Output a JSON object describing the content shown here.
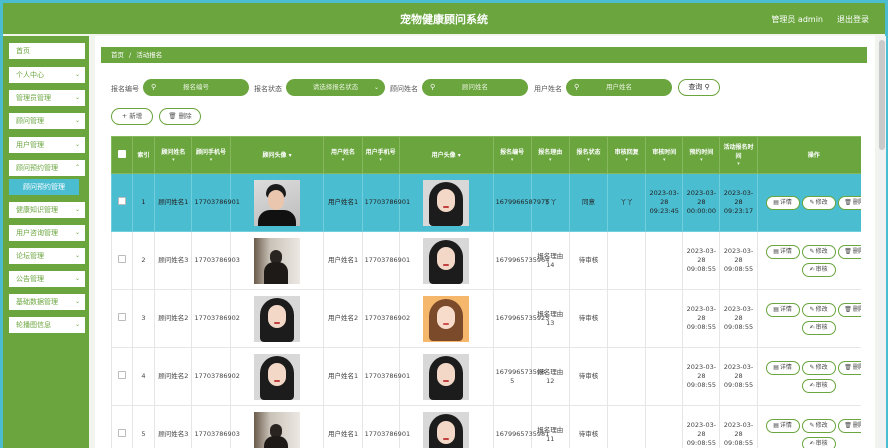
{
  "header": {
    "title": "宠物健康顾问系统",
    "admin": "管理员 admin",
    "logout": "退出登录"
  },
  "sidebar": {
    "items": [
      "首页",
      "个人中心",
      "管理员管理",
      "顾问管理",
      "用户管理",
      "顾问预约管理",
      "健康知识管理",
      "用户咨询管理",
      "论坛管理",
      "公告管理",
      "基础数据管理",
      "轮播图信息"
    ],
    "sub_item": "顾问预约管理"
  },
  "breadcrumb": {
    "home": "首页",
    "sep": "/",
    "current": "活动报名"
  },
  "filters": {
    "f1_label": "报名编号",
    "f1_placeholder": "报名编号",
    "f2_label": "报名状态",
    "f2_placeholder": "请选择报名状态",
    "f3_label": "顾问姓名",
    "f3_placeholder": "顾问姓名",
    "f4_label": "用户姓名",
    "f4_placeholder": "用户姓名",
    "query": "查询"
  },
  "actions": {
    "add": "新增",
    "delete": "删除"
  },
  "table": {
    "headers": [
      "索引",
      "顾问姓名",
      "顾问手机号",
      "顾问头像",
      "用户姓名",
      "用户手机号",
      "用户头像",
      "报名编号",
      "报名理由",
      "报名状态",
      "审核回复",
      "审核时间",
      "预约时间",
      "活动报名时间",
      "操作"
    ],
    "rows": [
      {
        "idx": "1",
        "gname": "顾问姓名1",
        "gphone": "17703786901",
        "uname": "用户姓名1",
        "uphone": "17703786901",
        "code": "1679966587975",
        "reason": "丫丫",
        "status": "同意",
        "reply": "丫丫",
        "atime": "2023-03-28 09:23:45",
        "btime": "2023-03-28 00:00:00",
        "stime": "2023-03-28 09:23:17",
        "audit": ""
      },
      {
        "idx": "2",
        "gname": "顾问姓名3",
        "gphone": "17703786903",
        "uname": "用户姓名1",
        "uphone": "17703786901",
        "code": "1679965735964",
        "reason": "报名理由14",
        "status": "待审核",
        "reply": "",
        "atime": "",
        "btime": "2023-03-28 09:08:55",
        "stime": "2023-03-28 09:08:55",
        "audit": "审核"
      },
      {
        "idx": "3",
        "gname": "顾问姓名2",
        "gphone": "17703786902",
        "uname": "用户姓名2",
        "uphone": "17703786902",
        "code": "1679965735925",
        "reason": "报名理由13",
        "status": "待审核",
        "reply": "",
        "atime": "",
        "btime": "2023-03-28 09:08:55",
        "stime": "2023-03-28 09:08:55",
        "audit": "审核"
      },
      {
        "idx": "4",
        "gname": "顾问姓名2",
        "gphone": "17703786902",
        "uname": "用户姓名1",
        "uphone": "17703786901",
        "code": "167996573598 5",
        "reason": "报名理由12",
        "status": "待审核",
        "reply": "",
        "atime": "",
        "btime": "2023-03-28 09:08:55",
        "stime": "2023-03-28 09:08:55",
        "audit": "审核"
      },
      {
        "idx": "5",
        "gname": "顾问姓名3",
        "gphone": "17703786903",
        "uname": "用户姓名1",
        "uphone": "17703786901",
        "code": "1679965735981",
        "reason": "报名理由11",
        "status": "待审核",
        "reply": "",
        "atime": "",
        "btime": "2023-03-28 09:08:55",
        "stime": "2023-03-28 09:08:55",
        "audit": "审核"
      }
    ],
    "op_detail": "详情",
    "op_edit": "修改",
    "op_del": "删除"
  }
}
